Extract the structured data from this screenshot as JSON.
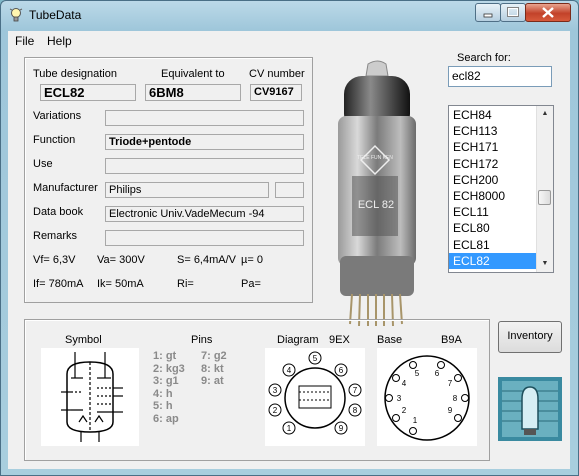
{
  "window": {
    "title": "TubeData"
  },
  "menu": {
    "file": "File",
    "help": "Help"
  },
  "info": {
    "designation_label": "Tube designation",
    "designation": "ECL82",
    "equivalent_label": "Equivalent to",
    "equivalent": "6BM8",
    "cv_label": "CV number",
    "cv": "CV9167",
    "variations_label": "Variations",
    "variations": "",
    "function_label": "Function",
    "function": "Triode+pentode",
    "use_label": "Use",
    "use": "",
    "manufacturer_label": "Manufacturer",
    "manufacturer": "Philips",
    "databook_label": "Data book",
    "databook": "Electronic Univ.VadeMecum -94",
    "remarks_label": "Remarks",
    "remarks": "",
    "vf": "Vf= 6,3V",
    "va": "Va=  300V",
    "s": "S= 6,4mA/V",
    "mu": "µ=    0",
    "if": "If= 780mA",
    "ik": "Ik=   50mA",
    "ri": "Ri=",
    "pa": "Pa="
  },
  "tube_photo": {
    "print1": "ECL 82",
    "logo": "TELE FUN KEN"
  },
  "search": {
    "label": "Search for:",
    "value": "ecl82"
  },
  "tube_list": {
    "items": [
      "ECH84",
      "ECH113",
      "ECH171",
      "ECH172",
      "ECH200",
      "ECH8000",
      "ECL11",
      "ECL80",
      "ECL81",
      "ECL82"
    ],
    "selected": "ECL82"
  },
  "bottom": {
    "symbol_label": "Symbol",
    "pins_label": "Pins",
    "diagram_label": "Diagram",
    "diagram_code": "9EX",
    "base_label": "Base",
    "base_code": "B9A",
    "pins_col1": [
      "1: gt",
      "2: kg3",
      "3: g1",
      "4: h",
      "5: h",
      "6: ap"
    ],
    "pins_col2": [
      "7: g2",
      "8: kt",
      "9: at"
    ]
  },
  "buttons": {
    "inventory": "Inventory"
  },
  "diagram_numbers": [
    "1",
    "2",
    "3",
    "4",
    "5",
    "6",
    "7",
    "8",
    "9"
  ],
  "base_numbers": [
    "1",
    "2",
    "3",
    "4",
    "5",
    "6",
    "7",
    "8",
    "9"
  ]
}
